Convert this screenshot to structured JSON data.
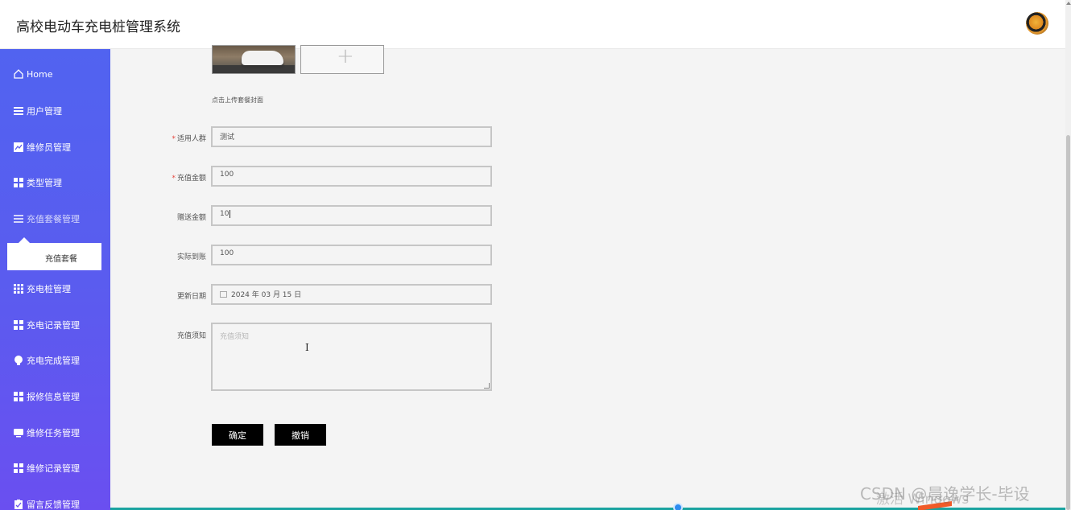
{
  "header": {
    "title": "高校电动车充电桩管理系统",
    "avatar": "avatar-icon"
  },
  "sidebar": {
    "items": [
      {
        "label": "Home",
        "icon": "home-icon"
      },
      {
        "label": "用户管理",
        "icon": "list-icon"
      },
      {
        "label": "维修员管理",
        "icon": "chart-icon"
      },
      {
        "label": "类型管理",
        "icon": "grid-icon"
      },
      {
        "label": "充值套餐管理",
        "icon": "list-icon"
      },
      {
        "label": "充电桩管理",
        "icon": "grid-icon"
      },
      {
        "label": "充电记录管理",
        "icon": "grid-icon"
      },
      {
        "label": "充电完成管理",
        "icon": "bulb-icon"
      },
      {
        "label": "报修信息管理",
        "icon": "grid-icon"
      },
      {
        "label": "维修任务管理",
        "icon": "monitor-icon"
      },
      {
        "label": "维修记录管理",
        "icon": "grid-icon"
      },
      {
        "label": "留言反馈管理",
        "icon": "clipboard-icon"
      }
    ],
    "submenu": {
      "label": "充值套餐"
    }
  },
  "form": {
    "upload_hint": "点击上传套餐封面",
    "fields": {
      "crowd": {
        "label": "适用人群",
        "value": "测试",
        "required": true
      },
      "amount": {
        "label": "充值金额",
        "value": "100",
        "required": true
      },
      "gift": {
        "label": "赠送金额",
        "value": "10",
        "required": false
      },
      "actual": {
        "label": "实际到账",
        "value": "100",
        "required": false
      },
      "date": {
        "label": "更新日期",
        "value": "2024 年 03 月 15 日",
        "required": false
      },
      "notice": {
        "label": "充值须知",
        "placeholder": "充值须知",
        "required": false
      }
    },
    "buttons": {
      "confirm": "确定",
      "cancel": "撤销"
    }
  },
  "watermark": {
    "text": "CSDN @晨逸学长-毕设",
    "overlay": "激活 Windows"
  },
  "colors": {
    "sidebar_top": "#5163f0",
    "sidebar_bottom": "#6a4ff0",
    "button": "#000000",
    "required": "#e5453c"
  }
}
